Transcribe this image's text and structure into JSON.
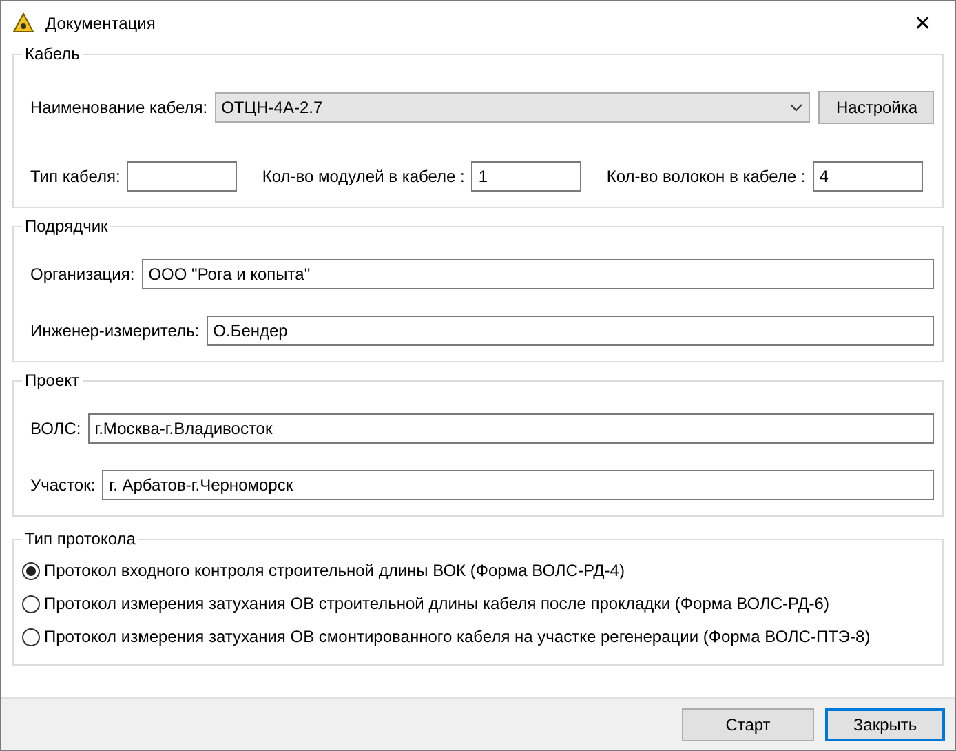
{
  "window": {
    "title": "Документация",
    "close": "✕"
  },
  "cable": {
    "legend": "Кабель",
    "name_label": "Наименование кабеля:",
    "name_value": "ОТЦН-4А-2.7",
    "settings_button": "Настройка",
    "fields": [
      {
        "label": "Тип кабеля:"
      },
      {
        "label": "Кол-во модулей в кабеле :",
        "value": "1"
      },
      {
        "label": "Кол-во волокон в кабеле :",
        "value": "4"
      }
    ]
  },
  "contractor": {
    "legend": "Подрядчик",
    "fields": [
      {
        "label": "Организация:",
        "value": "ООО \"Рога и копыта\""
      },
      {
        "label": "Инженер-измеритель:",
        "value": "О.Бендер"
      }
    ]
  },
  "project": {
    "legend": "Проект",
    "fields": [
      {
        "label": "ВОЛС:",
        "value": "г.Москва-г.Владивосток"
      },
      {
        "label": "Участок:",
        "value": "г. Арбатов-г.Черноморск"
      }
    ]
  },
  "protocol": {
    "legend": "Тип протокола",
    "options": [
      {
        "label": "Протокол входного контроля строительной длины ВОК (Форма ВОЛС-РД-4)",
        "selected": true
      },
      {
        "label": "Протокол измерения затухания ОВ строительной длины кабеля после прокладки (Форма ВОЛС-РД-6)",
        "selected": false
      },
      {
        "label": "Протокол измерения затухания ОВ смонтированного кабеля на участке регенерации (Форма ВОЛС-ПТЭ-8)",
        "selected": false
      }
    ]
  },
  "buttons": [
    {
      "label": "Старт",
      "default": false
    },
    {
      "label": "Закрыть",
      "default": true
    }
  ]
}
